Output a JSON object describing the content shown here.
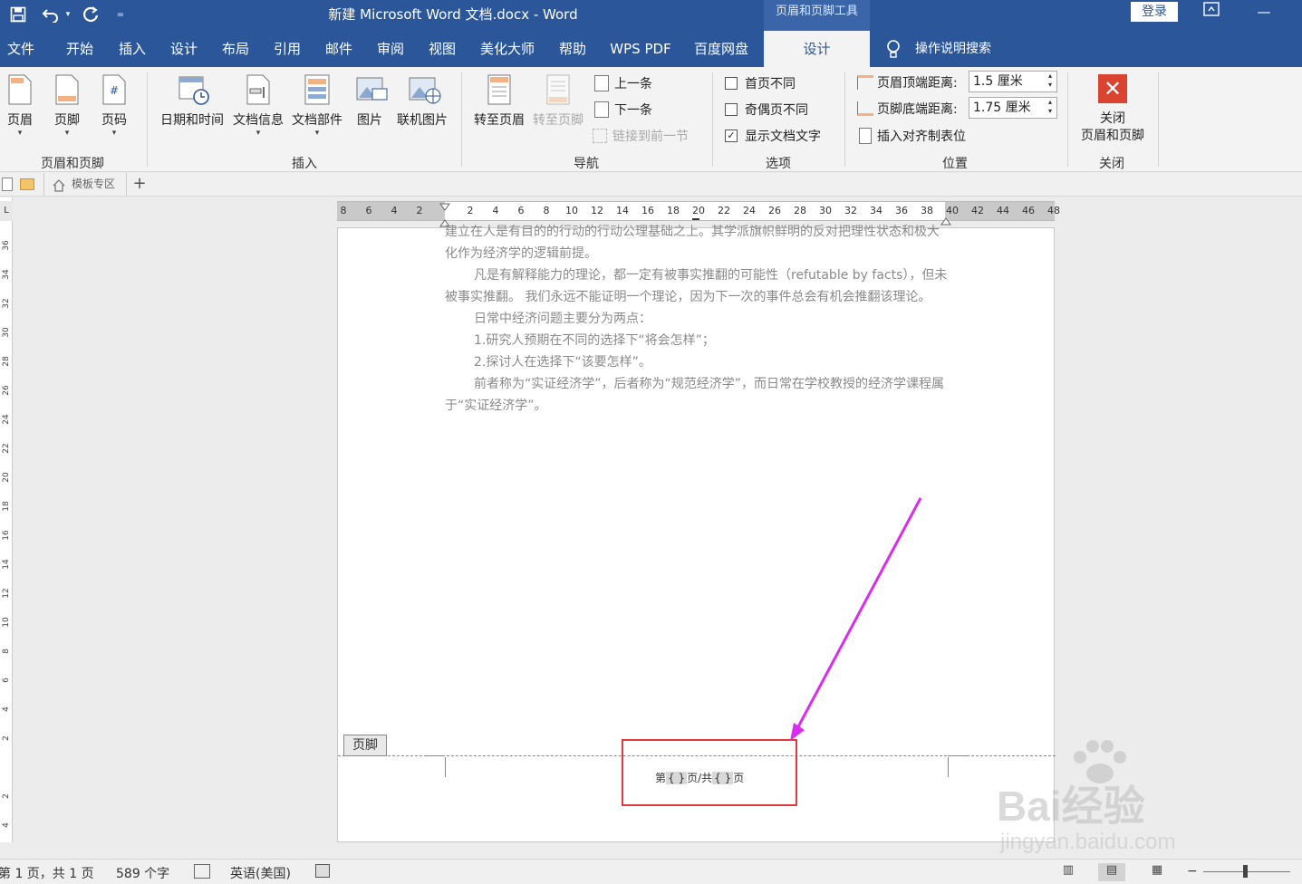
{
  "window": {
    "title": "新建 Microsoft Word 文档.docx  -  Word",
    "context_tools": "页眉和页脚工具",
    "login": "登录",
    "qa_more": "="
  },
  "tabs": [
    {
      "label": "文件"
    },
    {
      "label": "开始"
    },
    {
      "label": "插入"
    },
    {
      "label": "设计"
    },
    {
      "label": "布局"
    },
    {
      "label": "引用"
    },
    {
      "label": "邮件"
    },
    {
      "label": "审阅"
    },
    {
      "label": "视图"
    },
    {
      "label": "美化大师"
    },
    {
      "label": "帮助"
    },
    {
      "label": "WPS PDF"
    },
    {
      "label": "百度网盘"
    },
    {
      "label": "设计",
      "active": true
    }
  ],
  "tell_me": "操作说明搜索",
  "ribbon": {
    "hf_group": {
      "label": "页眉和页脚",
      "header": "页眉",
      "footer": "页脚",
      "page_number": "页码"
    },
    "insert_group": {
      "label": "插入",
      "datetime": "日期和时间",
      "docinfo": "文档信息",
      "quickparts": "文档部件",
      "picture": "图片",
      "online_picture": "联机图片"
    },
    "nav_group": {
      "label": "导航",
      "goto_header": "转至页眉",
      "goto_footer": "转至页脚",
      "previous": "上一条",
      "next": "下一条",
      "link_prev": "链接到前一节"
    },
    "options_group": {
      "label": "选项",
      "diff_first": "首页不同",
      "diff_odd_even": "奇偶页不同",
      "show_doc_text": "显示文档文字",
      "diff_first_checked": false,
      "diff_odd_even_checked": false,
      "show_doc_text_checked": true
    },
    "position_group": {
      "label": "位置",
      "header_top_label": "页眉顶端距离:",
      "header_top_value": "1.5 厘米",
      "footer_bottom_label": "页脚底端距离:",
      "footer_bottom_value": "1.75 厘米",
      "insert_align_tab": "插入对齐制表位"
    },
    "close_group": {
      "label": "关闭",
      "close_line1": "关闭",
      "close_line2": "页眉和页脚"
    }
  },
  "doc_tabs": {
    "template": "模板专区",
    "add": "+"
  },
  "ruler": {
    "ticks": [
      "8",
      "6",
      "4",
      "2",
      "",
      "2",
      "4",
      "6",
      "8",
      "10",
      "12",
      "14",
      "16",
      "18",
      "20",
      "22",
      "24",
      "26",
      "28",
      "30",
      "32",
      "34",
      "36",
      "38",
      "40",
      "42",
      "44",
      "46",
      "48"
    ],
    "vticks": [
      "36",
      "34",
      "32",
      "30",
      "28",
      "26",
      "24",
      "22",
      "20",
      "18",
      "16",
      "14",
      "12",
      "10",
      "8",
      "6",
      "4",
      "2",
      "",
      "2",
      "4"
    ]
  },
  "document": {
    "paragraphs": [
      "建立在人是有目的的行动的行动公理基础之上。其学派旗帜鲜明的反对把理性状态和极大",
      "化作为经济学的逻辑前提。",
      "凡是有解释能力的理论，都一定有被事实推翻的可能性（refutable by facts），但未",
      "被事实推翻。 我们永远不能证明一个理论，因为下一次的事件总会有机会推翻该理论。",
      "日常中经济问题主要分为两点：",
      "1.研究人预期在不同的选择下“将会怎样”；",
      "2.探讨人在选择下“该要怎样”。",
      "前者称为“实证经济学”，后者称为“规范经济学”，而日常在学校教授的经济学课程属",
      "于“实证经济学”。"
    ],
    "footer_tag": "页脚",
    "footer_parts": {
      "p1": "第",
      "f1": "{  }",
      "p2": "页/共",
      "f2": "{  }",
      "p3": "页"
    }
  },
  "status": {
    "page": "第 1 页，共 1 页",
    "words": "589 个字",
    "language": "英语(美国)"
  },
  "watermark": {
    "brand": "Bai经验",
    "url": "jingyan.baidu.com"
  },
  "colors": {
    "word_blue": "#2b579a",
    "annotation_red": "#e03a3a",
    "arrow_magenta": "#d92cf0"
  }
}
